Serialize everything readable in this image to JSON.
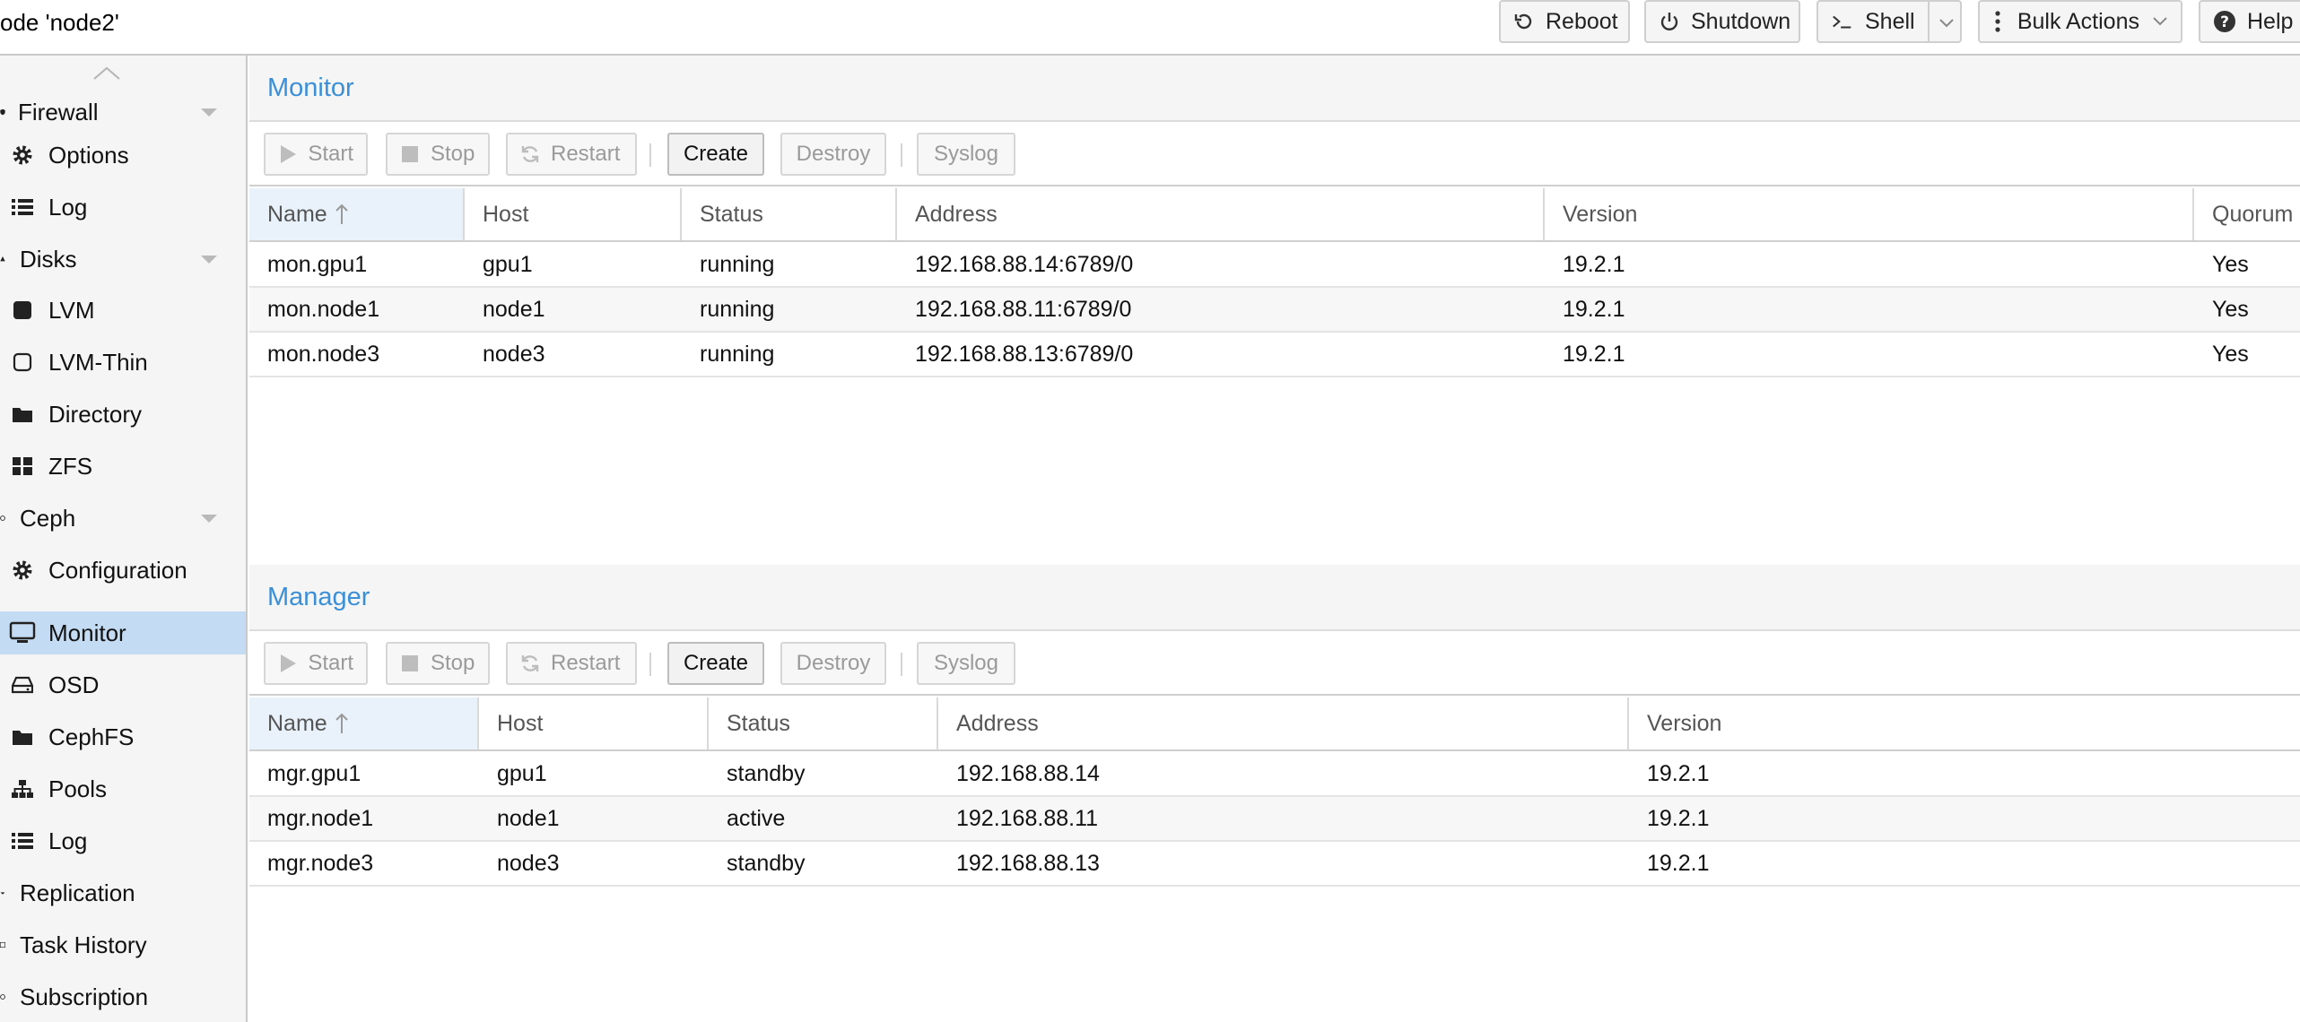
{
  "header": {
    "node_title": "ode 'node2'",
    "buttons": {
      "reboot": "Reboot",
      "shutdown": "Shutdown",
      "shell": "Shell",
      "bulk_actions": "Bulk Actions",
      "help": "Help"
    }
  },
  "sidebar": {
    "items": [
      {
        "label": "Firewall",
        "icon": "shield-icon",
        "expandable": true
      },
      {
        "label": "Options",
        "icon": "gear-icon"
      },
      {
        "label": "Log",
        "icon": "list-icon"
      },
      {
        "label": "Disks",
        "icon": "disk-icon",
        "expandable": true
      },
      {
        "label": "LVM",
        "icon": "square-icon"
      },
      {
        "label": "LVM-Thin",
        "icon": "square-outline-icon"
      },
      {
        "label": "Directory",
        "icon": "folder-icon"
      },
      {
        "label": "ZFS",
        "icon": "grid-icon"
      },
      {
        "label": "Ceph",
        "icon": "ceph-icon",
        "expandable": true
      },
      {
        "label": "Configuration",
        "icon": "gear-icon"
      },
      {
        "label": "Monitor",
        "icon": "desktop-icon",
        "selected": true
      },
      {
        "label": "OSD",
        "icon": "hdd-icon"
      },
      {
        "label": "CephFS",
        "icon": "folder-icon"
      },
      {
        "label": "Pools",
        "icon": "sitemap-icon"
      },
      {
        "label": "Log",
        "icon": "list-icon"
      },
      {
        "label": "Replication",
        "icon": "retweet-icon"
      },
      {
        "label": "Task History",
        "icon": "list-alt-icon"
      },
      {
        "label": "Subscription",
        "icon": "support-icon"
      }
    ]
  },
  "toolbar_labels": {
    "start": "Start",
    "stop": "Stop",
    "restart": "Restart",
    "create": "Create",
    "destroy": "Destroy",
    "syslog": "Syslog"
  },
  "monitor": {
    "title": "Monitor",
    "columns": [
      "Name",
      "Host",
      "Status",
      "Address",
      "Version",
      "Quorum"
    ],
    "rows": [
      {
        "name": "mon.gpu1",
        "host": "gpu1",
        "status": "running",
        "address": "192.168.88.14:6789/0",
        "version": "19.2.1",
        "quorum": "Yes"
      },
      {
        "name": "mon.node1",
        "host": "node1",
        "status": "running",
        "address": "192.168.88.11:6789/0",
        "version": "19.2.1",
        "quorum": "Yes"
      },
      {
        "name": "mon.node3",
        "host": "node3",
        "status": "running",
        "address": "192.168.88.13:6789/0",
        "version": "19.2.1",
        "quorum": "Yes"
      }
    ]
  },
  "manager": {
    "title": "Manager",
    "columns": [
      "Name",
      "Host",
      "Status",
      "Address",
      "Version"
    ],
    "rows": [
      {
        "name": "mgr.gpu1",
        "host": "gpu1",
        "status": "standby",
        "address": "192.168.88.14",
        "version": "19.2.1"
      },
      {
        "name": "mgr.node1",
        "host": "node1",
        "status": "active",
        "address": "192.168.88.11",
        "version": "19.2.1"
      },
      {
        "name": "mgr.node3",
        "host": "node3",
        "status": "standby",
        "address": "192.168.88.13",
        "version": "19.2.1"
      }
    ]
  }
}
